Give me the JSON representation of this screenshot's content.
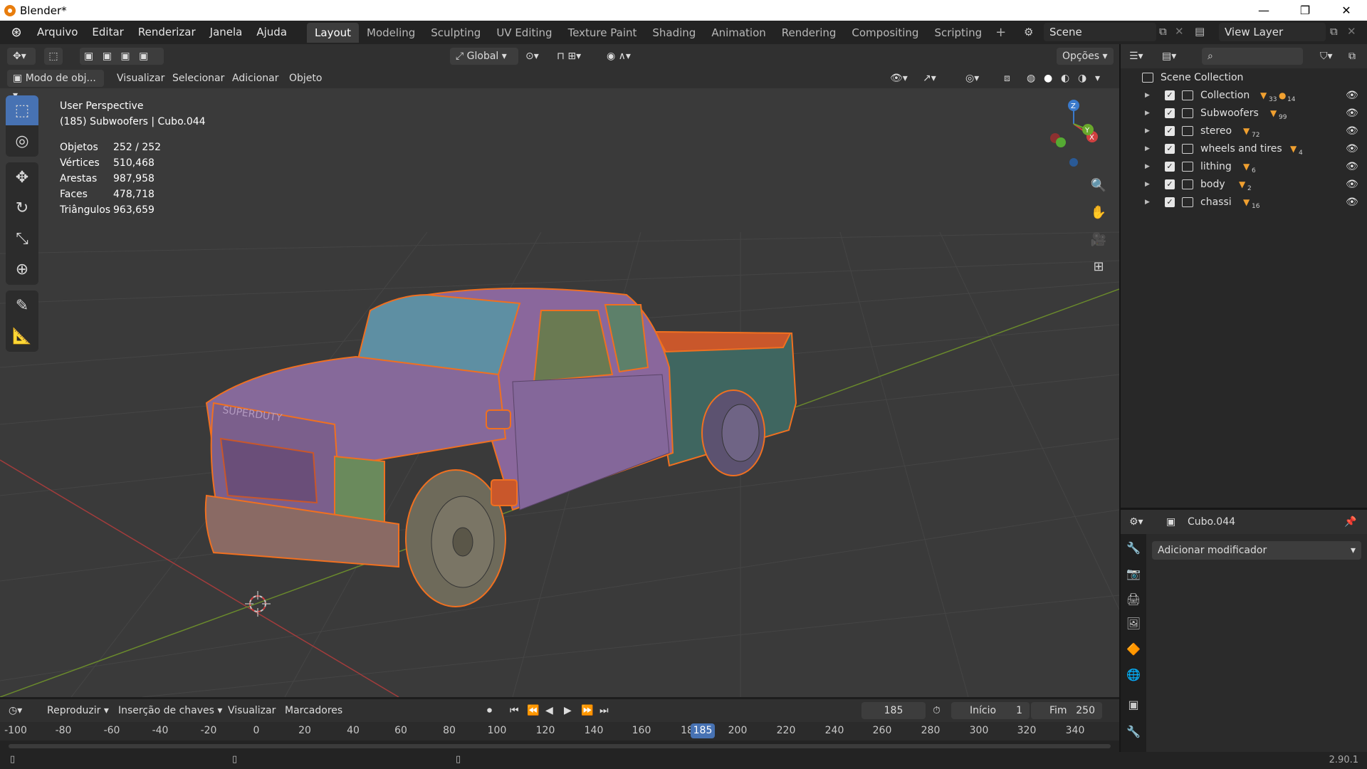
{
  "window": {
    "title": "Blender*",
    "controls": [
      "—",
      "❐",
      "✕"
    ]
  },
  "menu": {
    "items": [
      "Arquivo",
      "Editar",
      "Renderizar",
      "Janela",
      "Ajuda"
    ]
  },
  "workspaces": {
    "tabs": [
      "Layout",
      "Modeling",
      "Sculpting",
      "UV Editing",
      "Texture Paint",
      "Shading",
      "Animation",
      "Rendering",
      "Compositing",
      "Scripting"
    ],
    "active": "Layout",
    "add_label": "+"
  },
  "scene": {
    "name": "Scene",
    "view_layer": "View Layer"
  },
  "viewport_header": {
    "orientation": "Global",
    "options_label": "Opções",
    "mode": "Modo de obj...",
    "menus": [
      "Visualizar",
      "Selecionar",
      "Adicionar",
      "Objeto"
    ]
  },
  "viewport": {
    "perspective": "User Perspective",
    "context": "(185) Subwoofers | Cubo.044",
    "stats": [
      {
        "label": "Objetos",
        "value": "252 / 252"
      },
      {
        "label": "Vértices",
        "value": "510,468"
      },
      {
        "label": "Arestas",
        "value": "987,958"
      },
      {
        "label": "Faces",
        "value": "478,718"
      },
      {
        "label": "Triângulos",
        "value": "963,659"
      }
    ],
    "gizmo": {
      "x": "X",
      "y": "Y",
      "z": "Z"
    },
    "car_text": "SUPERDUTY"
  },
  "timeline": {
    "menus": [
      "Reproduzir",
      "Inserção de chaves",
      "Visualizar",
      "Marcadores"
    ],
    "current_frame": "185",
    "start_label": "Início",
    "start_value": "1",
    "end_label": "Fim",
    "end_value": "250",
    "ticks": [
      "-100",
      "-80",
      "-60",
      "-40",
      "-20",
      "0",
      "20",
      "40",
      "60",
      "80",
      "100",
      "120",
      "140",
      "160",
      "18",
      "200",
      "220",
      "240",
      "260",
      "280",
      "300",
      "320",
      "340"
    ],
    "playhead_label": "185"
  },
  "outliner": {
    "root": "Scene Collection",
    "collections": [
      {
        "name": "Collection",
        "count": "33",
        "count2": "14"
      },
      {
        "name": "Subwoofers",
        "count": "99"
      },
      {
        "name": "stereo",
        "count": "72"
      },
      {
        "name": "wheels and tires",
        "count": "4"
      },
      {
        "name": "lithing",
        "count": "6"
      },
      {
        "name": "body",
        "count": "2"
      },
      {
        "name": "chassi",
        "count": "16"
      }
    ]
  },
  "properties": {
    "object_name": "Cubo.044",
    "add_modifier": "Adicionar modificador"
  },
  "status": {
    "version": "2.90.1"
  },
  "colors": {
    "accent": "#4772b3",
    "selection_outline": "#f07020",
    "viewport_bg": "#3a3a3a"
  }
}
